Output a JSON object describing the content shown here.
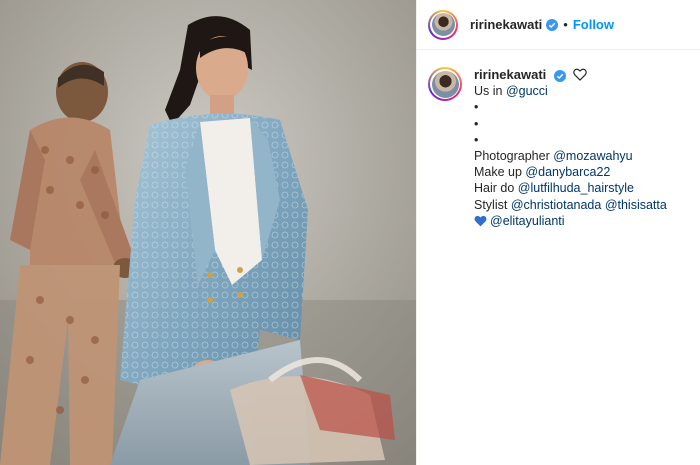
{
  "colors": {
    "accent": "#0095f6",
    "mention": "#00376b",
    "text": "#262626",
    "verified": "#3897f0"
  },
  "header": {
    "username": "ririnekawati",
    "separator": "•",
    "follow_label": "Follow"
  },
  "caption": {
    "username": "ririnekawati",
    "line1_prefix": "Us in ",
    "line1_mention": "@gucci",
    "bullets": [
      "•",
      "•",
      "•"
    ],
    "photographer_label": "Photographer ",
    "photographer_mention": "@mozawahyu",
    "makeup_label": "Make up ",
    "makeup_mention": "@danybarca22",
    "hair_label": "Hair do ",
    "hair_mention": "@lutfilhuda_hairstyle",
    "stylist_label": "Stylist ",
    "stylist_mention1": "@christiotanada",
    "stylist_mention2": "@thisisatta",
    "heart_mention": "@elitayulianti"
  },
  "icons": {
    "verified": "verified-badge-icon",
    "like": "heart-outline-icon",
    "emoji": "blue-heart-emoji"
  }
}
